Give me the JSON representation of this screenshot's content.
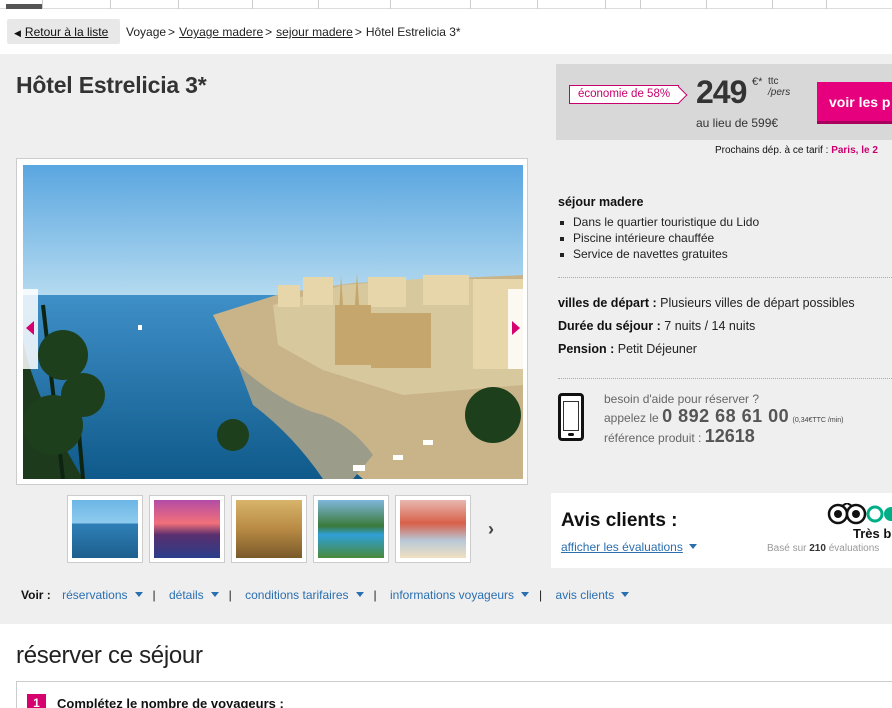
{
  "breadcrumb": {
    "back_label": "Retour à la liste",
    "items": [
      "Voyage",
      "Voyage madere",
      "sejour madere",
      "Hôtel Estrelicia 3*"
    ],
    "separator": ">"
  },
  "hotel": {
    "title": "Hôtel Estrelicia 3*"
  },
  "price": {
    "economy_badge": "économie de 58%",
    "amount": "249",
    "currency": "€*",
    "unit_line1": "ttc",
    "unit_line2": "/pers",
    "old_price": "au lieu de 599€",
    "cta_label": "voir les p",
    "next_departures_label": "Prochains dép. à ce tarif :",
    "next_departures_value": "Paris, le 2"
  },
  "stay": {
    "title": "séjour madere",
    "features": [
      "Dans le quartier touristique du Lido",
      "Piscine intérieure chauffée",
      "Service de navettes gratuites"
    ],
    "departure_label": "villes de départ :",
    "departure_value": "Plusieurs villes de départ possibles",
    "duration_label": "Durée du séjour :",
    "duration_value": "7 nuits / 14 nuits",
    "board_label": "Pension :",
    "board_value": "Petit Déjeuner"
  },
  "help": {
    "question": "besoin d'aide pour réserver ?",
    "call_label": "appelez le",
    "phone": "0 892 68 61 00",
    "rate": "(0,34€TTC /min)",
    "ref_label": "référence produit :",
    "ref_code": "12618"
  },
  "reviews": {
    "title": "Avis clients :",
    "link": "afficher les évaluations",
    "rating_label": "Très b",
    "based_prefix": "Basé sur",
    "count": "210",
    "based_suffix": "évaluations"
  },
  "voir": {
    "label": "Voir :",
    "items": [
      "réservations",
      "détails",
      "conditions tarifaires",
      "informations voyageurs",
      "avis clients"
    ]
  },
  "booking": {
    "title": "réserver ce séjour",
    "step_number": "1",
    "step_text": "Complétez le nombre de voyageurs :"
  },
  "colors": {
    "brand": "#e6007e",
    "link": "#2a6fb0",
    "tripadvisor": "#00af87"
  }
}
